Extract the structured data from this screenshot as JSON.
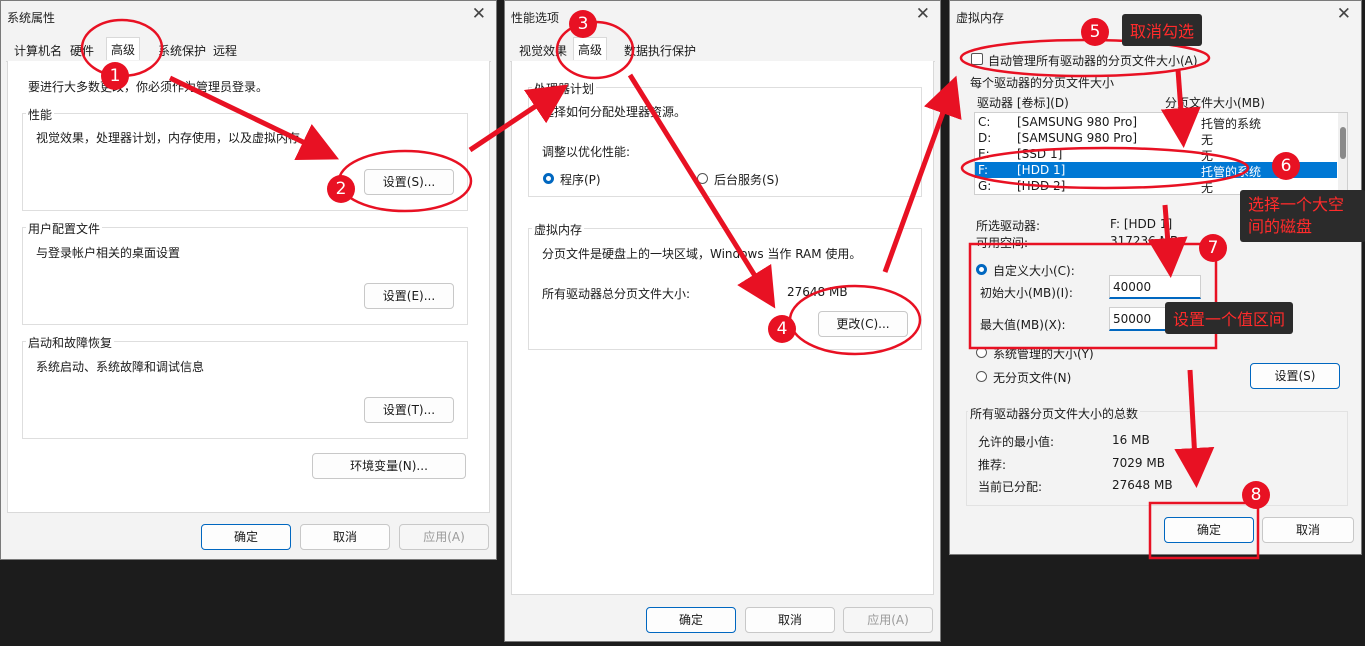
{
  "sysprop": {
    "title": "系统属性",
    "tabs": [
      "计算机名",
      "硬件",
      "高级",
      "系统保护",
      "远程"
    ],
    "admin_note": "要进行大多数更改，你必须作为管理员登录。",
    "performance": {
      "label": "性能",
      "desc": "视觉效果，处理器计划，内存使用，以及虚拟内存",
      "button": "设置(S)..."
    },
    "user_profiles": {
      "label": "用户配置文件",
      "desc": "与登录帐户相关的桌面设置",
      "button": "设置(E)..."
    },
    "startup": {
      "label": "启动和故障恢复",
      "desc": "系统启动、系统故障和调试信息",
      "button": "设置(T)..."
    },
    "env_button": "环境变量(N)...",
    "ok": "确定",
    "cancel": "取消",
    "apply": "应用(A)"
  },
  "perfopt": {
    "title": "性能选项",
    "tabs": [
      "视觉效果",
      "高级",
      "数据执行保护"
    ],
    "sched": {
      "label": "处理器计划",
      "desc": "选择如何分配处理器资源。",
      "adjust": "调整以优化性能:",
      "programs": "程序(P)",
      "services": "后台服务(S)"
    },
    "vm": {
      "label": "虚拟内存",
      "desc": "分页文件是硬盘上的一块区域，Windows 当作 RAM 使用。",
      "total_label": "所有驱动器总分页文件大小:",
      "total_value": "27648 MB",
      "change_button": "更改(C)..."
    },
    "ok": "确定",
    "cancel": "取消",
    "apply": "应用(A)"
  },
  "vmem": {
    "title": "虚拟内存",
    "auto_manage": "自动管理所有驱动器的分页文件大小(A)",
    "each_drive": "每个驱动器的分页文件大小",
    "col_drive": "驱动器 [卷标](D)",
    "col_size": "分页文件大小(MB)",
    "drives": [
      {
        "letter": "C:",
        "label": "[SAMSUNG 980 Pro]",
        "size": "托管的系统"
      },
      {
        "letter": "D:",
        "label": "[SAMSUNG 980 Pro]",
        "size": "无"
      },
      {
        "letter": "E:",
        "label": "[SSD 1]",
        "size": "无"
      },
      {
        "letter": "F:",
        "label": "[HDD 1]",
        "size": "托管的系统"
      },
      {
        "letter": "G:",
        "label": "[HDD 2]",
        "size": "无"
      }
    ],
    "selected_drive_label": "所选驱动器:",
    "selected_drive_value": "F:  [HDD 1]",
    "free_space_label": "可用空间:",
    "free_space_value": "317236 MB",
    "custom_size": "自定义大小(C):",
    "initial_label": "初始大小(MB)(I):",
    "initial_value": "40000",
    "max_label": "最大值(MB)(X):",
    "max_value": "50000",
    "system_managed": "系统管理的大小(Y)",
    "no_paging": "无分页文件(N)",
    "set_button": "设置(S)",
    "totals_label": "所有驱动器分页文件大小的总数",
    "min_label": "允许的最小值:",
    "min_value": "16 MB",
    "rec_label": "推荐:",
    "rec_value": "7029 MB",
    "cur_label": "当前已分配:",
    "cur_value": "27648 MB",
    "ok": "确定",
    "cancel": "取消"
  },
  "annotations": {
    "steps": [
      "1",
      "2",
      "3",
      "4",
      "5",
      "6",
      "7",
      "8"
    ],
    "uncheck": "取消勾选",
    "choose_disk_line1": "选择一个大空",
    "choose_disk_line2": "间的磁盘",
    "set_range": "设置一个值区间",
    "color": "#e81123"
  }
}
